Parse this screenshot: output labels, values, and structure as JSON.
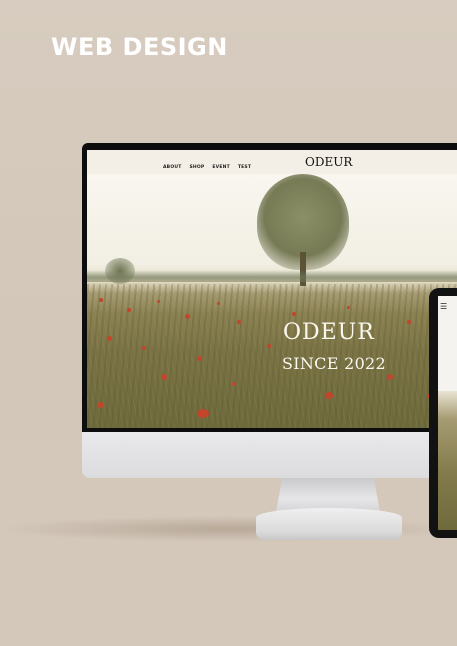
{
  "section_title": "WEB DESIGN",
  "site": {
    "logo": "ODEUR",
    "nav": [
      "ABOUT",
      "SHOP",
      "EVENT",
      "TEST"
    ],
    "hero_title": "ODEUR",
    "hero_subtitle": "SINCE 2022"
  },
  "phone": {
    "menu_icon": "☰"
  },
  "colors": {
    "background": "#d6cbbe",
    "title_text": "#ffffff",
    "poppy": "#c2452c"
  },
  "icons": [
    "hamburger-menu-icon"
  ]
}
